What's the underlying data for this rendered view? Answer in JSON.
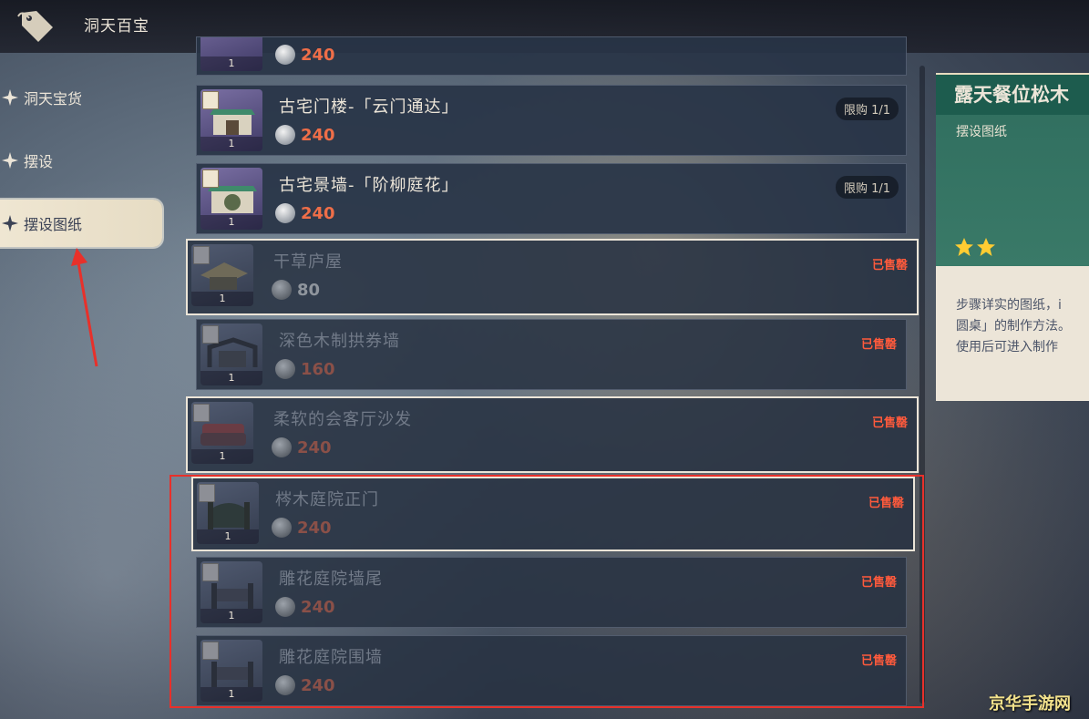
{
  "header": {
    "title": "洞天百宝",
    "icon": "price-tag-icon"
  },
  "sidebar": {
    "items": [
      {
        "label": "洞天宝货",
        "active": false
      },
      {
        "label": "摆设",
        "active": false
      },
      {
        "label": "摆设图纸",
        "active": true
      }
    ]
  },
  "list": {
    "partial_top_price": "240",
    "items": [
      {
        "name": "古宅门楼-「云门通达」",
        "price": "240",
        "qty": "1",
        "limit": "限购 1/1",
        "status": "",
        "sold": false
      },
      {
        "name": "古宅景墙-「阶柳庭花」",
        "price": "240",
        "qty": "1",
        "limit": "限购 1/1",
        "status": "",
        "sold": false
      },
      {
        "name": "干草庐屋",
        "price": "80",
        "qty": "1",
        "limit": "",
        "status": "已售罄",
        "sold": true
      },
      {
        "name": "深色木制拱券墙",
        "price": "160",
        "qty": "1",
        "limit": "",
        "status": "已售罄",
        "sold": true
      },
      {
        "name": "柔软的会客厅沙发",
        "price": "240",
        "qty": "1",
        "limit": "",
        "status": "已售罄",
        "sold": true
      },
      {
        "name": "梣木庭院正门",
        "price": "240",
        "qty": "1",
        "limit": "",
        "status": "已售罄",
        "sold": true
      },
      {
        "name": "雕花庭院墙尾",
        "price": "240",
        "qty": "1",
        "limit": "",
        "status": "已售罄",
        "sold": true
      },
      {
        "name": "雕花庭院围墙",
        "price": "240",
        "qty": "1",
        "limit": "",
        "status": "已售罄",
        "sold": true
      }
    ]
  },
  "detail": {
    "title": "露天餐位松木",
    "subtitle": "摆设图纸",
    "stars": 2,
    "description": "步骤详实的图纸，i\n圆桌」的制作方法。\n使用后可进入制作"
  },
  "watermark": "京华手游网",
  "colors": {
    "accent_price": "#ef6e48",
    "sold_out": "#ff5a3c",
    "highlight_box": "#e8302a"
  }
}
